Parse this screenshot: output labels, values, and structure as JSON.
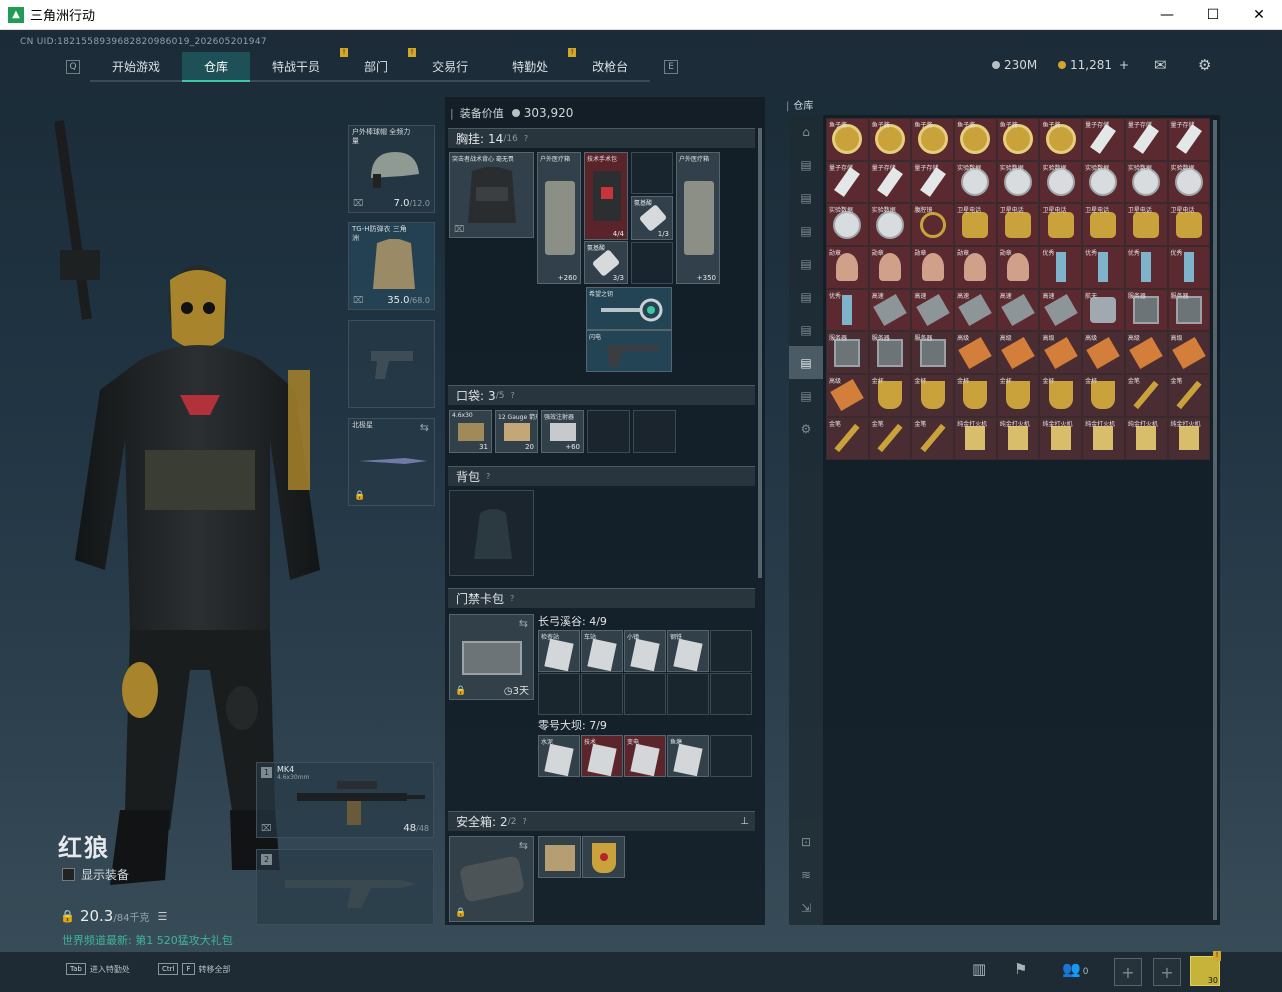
{
  "window": {
    "title": "三角洲行动",
    "minimize": "—",
    "maximize": "☐",
    "close": "✕"
  },
  "uid": "CN UID:1821558939682820986019_202605201947",
  "nav": {
    "tabs": [
      {
        "label": "开始游戏",
        "active": false,
        "flag": false
      },
      {
        "label": "仓库",
        "active": true,
        "flag": false
      },
      {
        "label": "特战干员",
        "active": false,
        "flag": true
      },
      {
        "label": "部门",
        "active": false,
        "flag": true
      },
      {
        "label": "交易行",
        "active": false,
        "flag": false
      },
      {
        "label": "特勤处",
        "active": false,
        "flag": true
      },
      {
        "label": "改枪台",
        "active": false,
        "flag": false
      }
    ],
    "left_key": "Q",
    "right_key": "E",
    "flag_mark": "!"
  },
  "currency": {
    "silver": "230M",
    "gold": "11,281",
    "gold_plus": "+"
  },
  "operator": {
    "name": "红狼",
    "show_equipment": "显示装备",
    "weight": "20.3",
    "weight_max": "/84千克",
    "promo": "世界频道最新: 第1 520猛攻大礼包"
  },
  "slots": {
    "helmet": {
      "label": "户外棒球帽 全频力量",
      "value": "7.0",
      "max": "/12.0"
    },
    "armor": {
      "label": "TG-H防弹衣 三角洲",
      "value": "35.0",
      "max": "/68.0"
    },
    "melee": {
      "label": "北极星"
    },
    "primary": {
      "label": "MK4",
      "sub": "4.6x30mm",
      "ammo": "48",
      "ammo_max": "/48",
      "index": "1"
    },
    "secondary": {
      "index": "2"
    }
  },
  "equipment_value": {
    "label": "装备价值",
    "value": "303,920"
  },
  "rig": {
    "label": "胸挂:",
    "count": "14",
    "max": "/16"
  },
  "rig_items": {
    "vest": "突击者战术背心 毫无畏",
    "med1": {
      "label": "户外医疗箱",
      "count": "+260"
    },
    "med2": {
      "label": "技术手术包",
      "count": "4/4"
    },
    "pill1": {
      "label": "氨基酸",
      "count": "1/3"
    },
    "med3": {
      "label": "户外医疗箱",
      "count": "+350"
    },
    "pill2": {
      "label": "氨基酸",
      "count": "3/3"
    },
    "key1": "希望之钥",
    "key2": "闪电"
  },
  "pocket": {
    "label": "口袋:",
    "count": "3",
    "max": "/5"
  },
  "pocket_items": [
    {
      "label": "4.6x30",
      "count": "31"
    },
    {
      "label": "12 Gauge 箭形弹",
      "count": "20"
    },
    {
      "label": "强效注射器",
      "count": "+60"
    }
  ],
  "backpack": {
    "label": "背包"
  },
  "keycard": {
    "label": "门禁卡包",
    "timer": "3天"
  },
  "keycard_groups": [
    {
      "label": "长弓溪谷:",
      "count": "4/9",
      "cards": [
        "检查站",
        "车站",
        "小镇",
        "钢铁"
      ]
    },
    {
      "label": "零号大坝:",
      "count": "7/9",
      "cards": [
        "水泥",
        "技术",
        "变电",
        "鱼塘"
      ]
    }
  ],
  "safebox": {
    "label": "安全箱:",
    "count": "2",
    "max": "/2"
  },
  "warehouse": {
    "label": "仓库"
  },
  "grid_labels": [
    "鱼子酱",
    "鱼子酱",
    "鱼子酱",
    "鱼子酱",
    "鱼子酱",
    "鱼子酱",
    "量子存储",
    "量子存储",
    "量子存储",
    "量子存储",
    "量子存储",
    "量子存储",
    "实验数据",
    "实验数据",
    "实验数据",
    "实验数据",
    "实验数据",
    "实验数据",
    "实验数据",
    "实验数据",
    "腹腔镜",
    "卫星电话",
    "卫星电话",
    "卫星电话",
    "卫星电话",
    "卫星电话",
    "卫星电话",
    "勋章",
    "勋章",
    "勋章",
    "勋章",
    "勋章",
    "优秀",
    "优秀",
    "优秀",
    "优秀",
    "优秀",
    "高速",
    "高速",
    "高速",
    "高速",
    "高速",
    "航天",
    "服务器",
    "服务器",
    "服务器",
    "服务器",
    "服务器",
    "高级",
    "高级",
    "高级",
    "高级",
    "高级",
    "高级",
    "高级",
    "金杯",
    "金杯",
    "金杯",
    "金杯",
    "金杯",
    "金杯",
    "金笔",
    "金笔",
    "金笔",
    "金笔",
    "金笔",
    "纯金打火机",
    "纯金打火机",
    "纯金打火机",
    "纯金打火机",
    "纯金打火机",
    "纯金打火机"
  ],
  "bottom": {
    "key1": {
      "key": "Tab",
      "label": "进入特勤处"
    },
    "key2": {
      "key": "Ctrl",
      "key_b": "F",
      "label": "转移全部"
    },
    "squad_count": "0",
    "plus": "+",
    "avatar_level": "30"
  },
  "colors": {
    "accent": "#3ec6a4",
    "grid_bg": "#5a2a30",
    "gold": "#d3a72a"
  }
}
